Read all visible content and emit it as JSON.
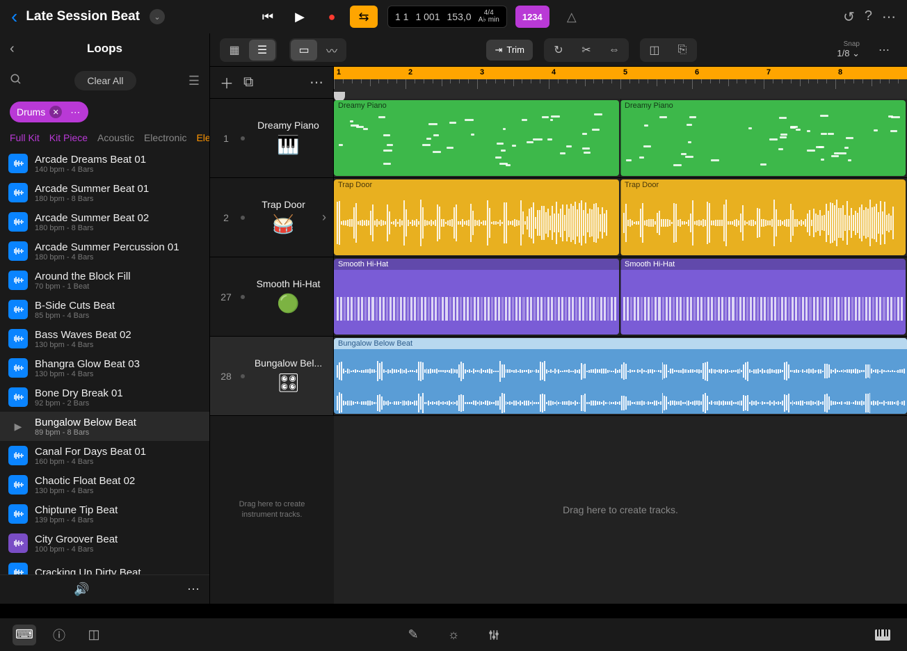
{
  "project": {
    "title": "Late Session Beat"
  },
  "transport": {
    "bars": "1 1",
    "subdiv": "1 001",
    "tempo": "153,0",
    "sig_top": "4/4",
    "sig_bot": "A♭ min",
    "countin": "1234"
  },
  "snap": {
    "label": "Snap",
    "value": "1/8"
  },
  "toolbar": {
    "trim_label": "Trim"
  },
  "sidebar": {
    "title": "Loops",
    "clear_all": "Clear All",
    "chip": "Drums",
    "subfilters": [
      "Full Kit",
      "Kit Piece",
      "Acoustic",
      "Electronic",
      "Ele"
    ],
    "loops": [
      {
        "name": "Arcade Dreams Beat 01",
        "meta": "140 bpm - 4 Bars",
        "kind": "blue"
      },
      {
        "name": "Arcade Summer Beat 01",
        "meta": "180 bpm - 8 Bars",
        "kind": "blue"
      },
      {
        "name": "Arcade Summer Beat 02",
        "meta": "180 bpm - 8 Bars",
        "kind": "blue"
      },
      {
        "name": "Arcade Summer Percussion 01",
        "meta": "180 bpm - 4 Bars",
        "kind": "blue"
      },
      {
        "name": "Around the Block Fill",
        "meta": "70 bpm - 1 Beat",
        "kind": "blue"
      },
      {
        "name": "B-Side Cuts Beat",
        "meta": "85 bpm - 4 Bars",
        "kind": "blue"
      },
      {
        "name": "Bass Waves Beat 02",
        "meta": "130 bpm - 4 Bars",
        "kind": "blue"
      },
      {
        "name": "Bhangra Glow Beat 03",
        "meta": "130 bpm - 4 Bars",
        "kind": "blue"
      },
      {
        "name": "Bone Dry Break 01",
        "meta": "92 bpm - 2 Bars",
        "kind": "blue"
      },
      {
        "name": "Bungalow Below Beat",
        "meta": "89 bpm - 8 Bars",
        "kind": "play",
        "selected": true
      },
      {
        "name": "Canal For Days Beat 01",
        "meta": "160 bpm - 4 Bars",
        "kind": "blue"
      },
      {
        "name": "Chaotic Float Beat 02",
        "meta": "130 bpm - 4 Bars",
        "kind": "blue"
      },
      {
        "name": "Chiptune Tip Beat",
        "meta": "139 bpm - 4 Bars",
        "kind": "blue"
      },
      {
        "name": "City Groover Beat",
        "meta": "100 bpm - 4 Bars",
        "kind": "purple"
      },
      {
        "name": "Cracking Up Dirty Beat",
        "meta": "",
        "kind": "blue"
      }
    ]
  },
  "tracks": [
    {
      "num": "1",
      "name": "Dreamy Piano",
      "icon": "🎹",
      "color": "green",
      "regions": [
        {
          "lbl": "Dreamy Piano"
        },
        {
          "lbl": "Dreamy Piano"
        }
      ]
    },
    {
      "num": "2",
      "name": "Trap Door",
      "icon": "🥁",
      "color": "yellow",
      "selected": false,
      "arrow": true,
      "regions": [
        {
          "lbl": "Trap Door"
        },
        {
          "lbl": "Trap Door"
        }
      ]
    },
    {
      "num": "27",
      "name": "Smooth Hi-Hat",
      "icon": "🟢",
      "color": "purple",
      "regions": [
        {
          "lbl": "Smooth Hi-Hat"
        },
        {
          "lbl": "Smooth Hi-Hat"
        }
      ]
    },
    {
      "num": "28",
      "name": "Bungalow Bel...",
      "icon": "🎛",
      "color": "blue",
      "selected": true,
      "regions": [
        {
          "lbl": "Bungalow Below Beat"
        }
      ]
    }
  ],
  "ruler": {
    "bars": [
      "1",
      "2",
      "3",
      "4",
      "5",
      "6",
      "7",
      "8"
    ]
  },
  "drop_hints": {
    "left": "Drag here to create instrument tracks.",
    "right": "Drag here to create tracks."
  }
}
